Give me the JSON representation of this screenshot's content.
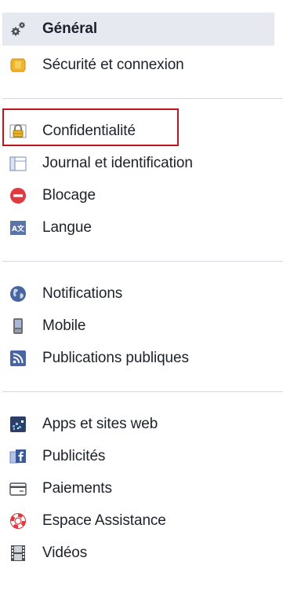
{
  "sidebar": {
    "general": {
      "label": "Général",
      "icon": "gears-icon"
    },
    "group1": [
      {
        "label": "Sécurité et connexion",
        "icon": "badge-icon"
      }
    ],
    "group2": [
      {
        "label": "Confidentialité",
        "icon": "lock-icon",
        "highlighted": true
      },
      {
        "label": "Journal et identification",
        "icon": "timeline-icon"
      },
      {
        "label": "Blocage",
        "icon": "block-icon"
      },
      {
        "label": "Langue",
        "icon": "language-icon"
      }
    ],
    "group3": [
      {
        "label": "Notifications",
        "icon": "globe-icon"
      },
      {
        "label": "Mobile",
        "icon": "mobile-icon"
      },
      {
        "label": "Publications publiques",
        "icon": "rss-icon"
      }
    ],
    "group4": [
      {
        "label": "Apps et sites web",
        "icon": "apps-icon"
      },
      {
        "label": "Publicités",
        "icon": "ads-icon"
      },
      {
        "label": "Paiements",
        "icon": "card-icon"
      },
      {
        "label": "Espace Assistance",
        "icon": "lifebuoy-icon"
      },
      {
        "label": "Vidéos",
        "icon": "film-icon"
      }
    ]
  },
  "colors": {
    "header_bg": "#e7e9f0",
    "highlight_border": "#c0131b",
    "text": "#1d2129",
    "divider": "#d3d6db"
  }
}
